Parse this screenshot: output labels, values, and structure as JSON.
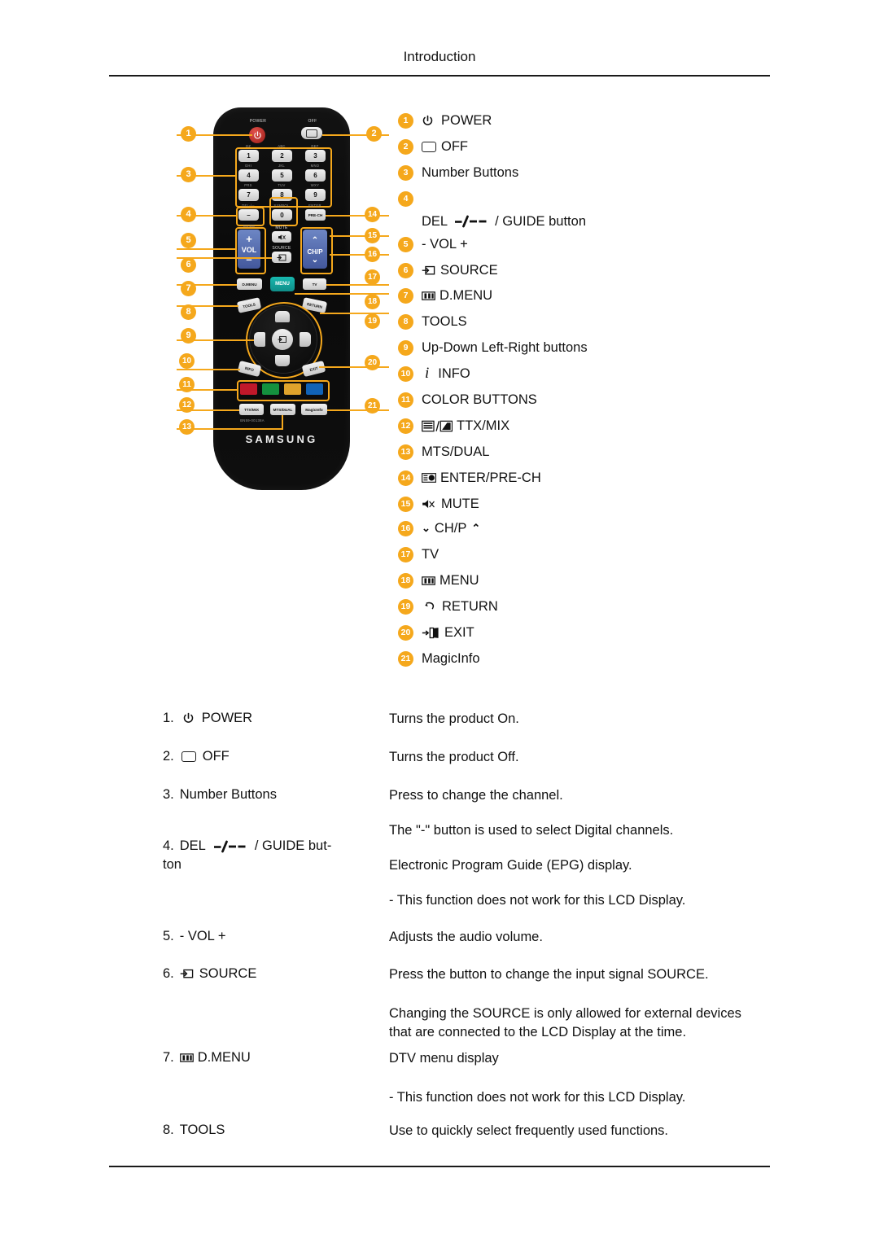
{
  "header": {
    "title": "Introduction"
  },
  "remote": {
    "brand": "SAMSUNG",
    "model_code": "BN59-00138A",
    "labels": {
      "power": "POWER",
      "off": "OFF",
      "del": "DEL-/--",
      "symbol": "SYMBOL",
      "enter": "ENTER",
      "prech": "PRE-CH",
      "guide": "GUIDE",
      "vol": "VOL",
      "mute": "MUTE",
      "source": "SOURCE",
      "chp": "CH/P",
      "dmenu": "D.MENU",
      "menu": "MENU",
      "tv": "TV",
      "tools": "TOOLS",
      "return": "RETURN",
      "info": "INFO",
      "exit": "EXIT",
      "ttxmix": "TTX/MIX",
      "mtsdual": "MTS/DUAL",
      "magicinfo": "MagicInfo"
    },
    "keypad": [
      {
        "letters": "QZ",
        "digit": "1"
      },
      {
        "letters": "ABC",
        "digit": "2"
      },
      {
        "letters": "DEF",
        "digit": "3"
      },
      {
        "letters": "GHI",
        "digit": "4"
      },
      {
        "letters": "JKL",
        "digit": "5"
      },
      {
        "letters": "MNO",
        "digit": "6"
      },
      {
        "letters": "PRS",
        "digit": "7"
      },
      {
        "letters": "TUV",
        "digit": "8"
      },
      {
        "letters": "WXY",
        "digit": "9"
      }
    ],
    "dash_key": "–",
    "zero_key": "0",
    "color_buttons": [
      "#c0182a",
      "#14913e",
      "#e0a32c",
      "#1163b6"
    ]
  },
  "callouts": {
    "left": [
      "1",
      "3",
      "4",
      "5",
      "6",
      "7",
      "8",
      "9",
      "10",
      "11",
      "12",
      "13"
    ],
    "right": [
      "2",
      "14",
      "15",
      "16",
      "17",
      "18",
      "19",
      "20",
      "21"
    ]
  },
  "legend": [
    {
      "num": "1",
      "icon": "power-icon",
      "label": "POWER"
    },
    {
      "num": "2",
      "icon": "off-icon",
      "label": "OFF"
    },
    {
      "num": "3",
      "icon": "none",
      "label": "Number Buttons"
    },
    {
      "num": "4",
      "icon": "dash-icon",
      "label": "DEL",
      "label2": "/ GUIDE button"
    },
    {
      "num": "5",
      "icon": "none",
      "label": "- VOL +"
    },
    {
      "num": "6",
      "icon": "source-icon",
      "label": "SOURCE"
    },
    {
      "num": "7",
      "icon": "dmenu-icon",
      "label": "D.MENU"
    },
    {
      "num": "8",
      "icon": "none",
      "label": "TOOLS"
    },
    {
      "num": "9",
      "icon": "none",
      "label": "Up-Down Left-Right buttons"
    },
    {
      "num": "10",
      "icon": "info-icon",
      "label": "INFO"
    },
    {
      "num": "11",
      "icon": "none",
      "label": "COLOR BUTTONS"
    },
    {
      "num": "12",
      "icon": "ttxmix-icon",
      "label": "TTX/MIX"
    },
    {
      "num": "13",
      "icon": "none",
      "label": "MTS/DUAL"
    },
    {
      "num": "14",
      "icon": "enter-icon",
      "label": "ENTER/PRE-CH"
    },
    {
      "num": "15",
      "icon": "mute-icon",
      "label": "MUTE"
    },
    {
      "num": "16",
      "icon": "chev-icon",
      "label": "CH/P"
    },
    {
      "num": "17",
      "icon": "none",
      "label": "TV"
    },
    {
      "num": "18",
      "icon": "menu-icon",
      "label": "MENU"
    },
    {
      "num": "19",
      "icon": "return-icon",
      "label": "RETURN"
    },
    {
      "num": "20",
      "icon": "exit-icon",
      "label": "EXIT"
    },
    {
      "num": "21",
      "icon": "none",
      "label": "MagicInfo"
    }
  ],
  "descriptions": [
    {
      "index": "1.",
      "icon": "power-icon",
      "term": "POWER",
      "lines": [
        "Turns the product On."
      ]
    },
    {
      "index": "2.",
      "icon": "off-icon",
      "term": "OFF",
      "lines": [
        "Turns the product Off."
      ]
    },
    {
      "index": "3.",
      "icon": "none",
      "term": "Number Buttons",
      "lines": [
        "Press to change the channel."
      ]
    },
    {
      "index": "4.",
      "icon": "dash-icon",
      "term": "DEL",
      "term2": "/ GUIDE but-",
      "term3": "ton",
      "lines": [
        "The \"-\" button is used to select Digital channels.",
        "Electronic Program Guide (EPG) display.",
        "- This function does not work for this LCD Display."
      ]
    },
    {
      "index": "5.",
      "icon": "none",
      "term": "- VOL +",
      "lines": [
        "Adjusts the audio volume."
      ]
    },
    {
      "index": "6.",
      "icon": "source-icon",
      "term": "SOURCE",
      "lines": [
        "Press the button to change the input signal SOURCE.",
        "Changing the SOURCE is only allowed for external devices",
        "that are connected to the LCD Display at the time."
      ]
    },
    {
      "index": "7.",
      "icon": "dmenu-icon",
      "term": "D.MENU",
      "lines": [
        "DTV menu display",
        "- This function does not work for this LCD Display."
      ]
    },
    {
      "index": "8.",
      "icon": "none",
      "term": "TOOLS",
      "lines": [
        "Use to quickly select frequently used functions."
      ]
    }
  ],
  "colors": {
    "accent": "#f5a81c",
    "text": "#111111",
    "rule": "#1a1a1a"
  }
}
